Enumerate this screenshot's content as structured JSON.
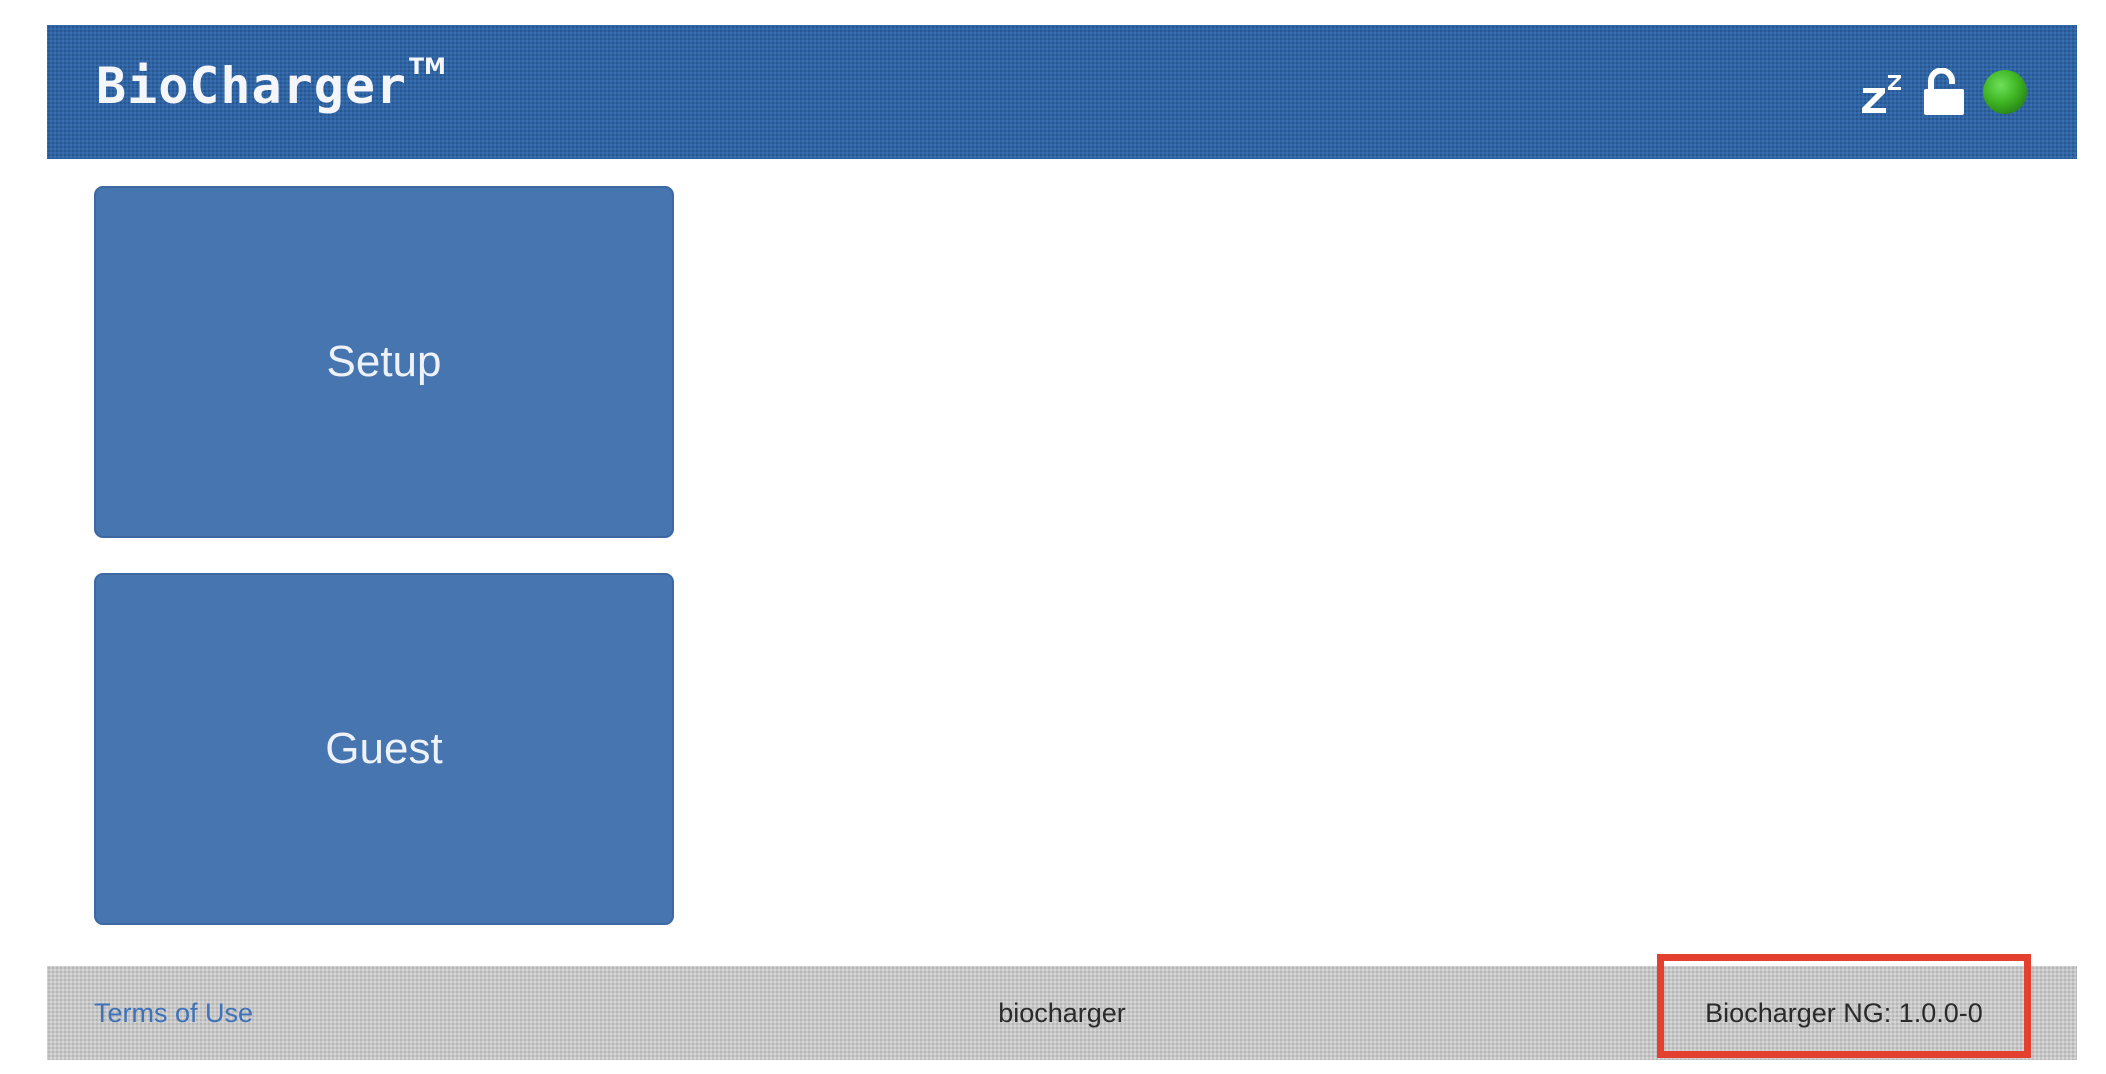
{
  "header": {
    "logo_text": "BioCharger",
    "logo_tm": "TM",
    "icons": {
      "sleep": "sleep-zz-icon",
      "lock": "unlocked-padlock-icon",
      "status": "green-status-indicator"
    },
    "status_color": "#3fb524"
  },
  "tiles": {
    "setup_label": "Setup",
    "guest_label": "Guest"
  },
  "footer": {
    "terms_label": "Terms of Use",
    "hostname": "biocharger",
    "version": "Biocharger NG: 1.0.0-0"
  },
  "colors": {
    "header_bg": "#2f66a8",
    "tile_bg": "#4675b0",
    "footer_bg": "#c9c9c9",
    "highlight": "#e4402f",
    "link": "#3d72b9"
  }
}
